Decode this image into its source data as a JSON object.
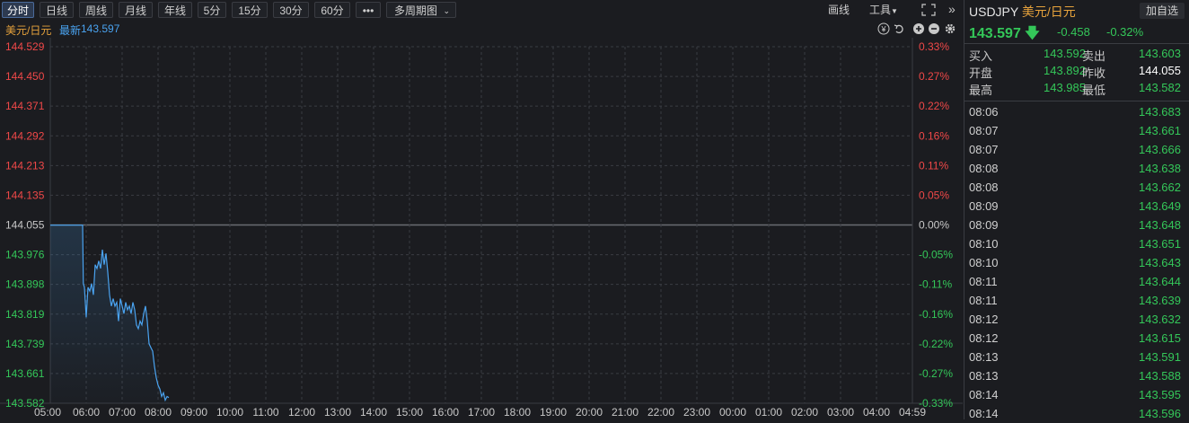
{
  "toolbar": {
    "periods": [
      "分时",
      "日线",
      "周线",
      "月线",
      "年线",
      "5分",
      "15分",
      "30分",
      "60分"
    ],
    "more_label": "•••",
    "multi_label": "多周期图",
    "draw_label": "画线",
    "tools_label": "工具"
  },
  "subheader": {
    "name": "美元/日元",
    "latest_label": "最新",
    "latest_value": "143.597"
  },
  "colors": {
    "up": "#f04848",
    "down": "#34c759",
    "line": "#4aa3f0",
    "neutral": "#c8c8c8"
  },
  "chart_data": {
    "type": "line",
    "y_ticks": [
      "144.529",
      "144.450",
      "144.371",
      "144.292",
      "144.213",
      "144.135",
      "144.055",
      "143.976",
      "143.898",
      "143.819",
      "143.739",
      "143.661",
      "143.582"
    ],
    "pct_ticks": [
      "0.33%",
      "0.27%",
      "0.22%",
      "0.16%",
      "0.11%",
      "0.05%",
      "0.00%",
      "-0.05%",
      "-0.11%",
      "-0.16%",
      "-0.22%",
      "-0.27%",
      "-0.33%"
    ],
    "x_ticks": [
      "05:00",
      "06:00",
      "07:00",
      "08:00",
      "09:00",
      "10:00",
      "11:00",
      "12:00",
      "13:00",
      "14:00",
      "15:00",
      "16:00",
      "17:00",
      "18:00",
      "19:00",
      "20:00",
      "21:00",
      "22:00",
      "23:00",
      "00:00",
      "01:00",
      "02:00",
      "03:00",
      "04:00",
      "04:59"
    ],
    "ylim": [
      143.582,
      144.529
    ],
    "prev_close": 144.055,
    "series": [
      {
        "x": [
          0.0,
          0.9,
          0.92,
          0.95,
          1.0,
          1.05,
          1.1,
          1.15,
          1.2,
          1.25,
          1.3,
          1.35,
          1.4,
          1.45,
          1.5,
          1.55,
          1.6,
          1.65,
          1.7,
          1.75,
          1.8,
          1.85,
          1.9,
          1.95,
          2.0,
          2.05,
          2.1,
          2.15,
          2.2,
          2.25,
          2.3,
          2.35,
          2.4,
          2.45,
          2.5,
          2.55,
          2.6,
          2.65,
          2.7,
          2.75,
          2.8,
          2.85,
          2.9,
          2.95,
          3.0,
          3.05,
          3.1,
          3.15,
          3.2,
          3.25,
          3.3
        ],
        "values": [
          144.055,
          144.055,
          143.9,
          143.89,
          143.81,
          143.89,
          143.88,
          143.9,
          143.87,
          143.95,
          143.94,
          143.96,
          143.94,
          143.99,
          143.95,
          143.98,
          143.93,
          143.87,
          143.84,
          143.86,
          143.84,
          143.85,
          143.8,
          143.86,
          143.84,
          143.82,
          143.85,
          143.83,
          143.84,
          143.82,
          143.85,
          143.83,
          143.79,
          143.78,
          143.8,
          143.79,
          143.82,
          143.84,
          143.8,
          143.74,
          143.73,
          143.72,
          143.68,
          143.65,
          143.63,
          143.62,
          143.6,
          143.61,
          143.59,
          143.6,
          143.597
        ]
      }
    ]
  },
  "panel": {
    "symbol": "USDJPY",
    "symbol_cn": "美元/日元",
    "add_label": "加自选",
    "price": "143.597",
    "change": "-0.458",
    "change_pct": "-0.32%",
    "quotes": [
      {
        "l1": "买入",
        "v1": "143.592",
        "c1": "down",
        "l2": "卖出",
        "v2": "143.603",
        "c2": "down"
      },
      {
        "l1": "开盘",
        "v1": "143.892",
        "c1": "down",
        "l2": "昨收",
        "v2": "144.055",
        "c2": "neutral"
      },
      {
        "l1": "最高",
        "v1": "143.985",
        "c1": "down",
        "l2": "最低",
        "v2": "143.582",
        "c2": "down"
      }
    ],
    "ticks": [
      {
        "time": "08:06",
        "price": "143.683"
      },
      {
        "time": "08:07",
        "price": "143.661"
      },
      {
        "time": "08:07",
        "price": "143.666"
      },
      {
        "time": "08:08",
        "price": "143.638"
      },
      {
        "time": "08:08",
        "price": "143.662"
      },
      {
        "time": "08:09",
        "price": "143.649"
      },
      {
        "time": "08:09",
        "price": "143.648"
      },
      {
        "time": "08:10",
        "price": "143.651"
      },
      {
        "time": "08:10",
        "price": "143.643"
      },
      {
        "time": "08:11",
        "price": "143.644"
      },
      {
        "time": "08:11",
        "price": "143.639"
      },
      {
        "time": "08:12",
        "price": "143.632"
      },
      {
        "time": "08:12",
        "price": "143.615"
      },
      {
        "time": "08:13",
        "price": "143.591"
      },
      {
        "time": "08:13",
        "price": "143.588"
      },
      {
        "time": "08:14",
        "price": "143.595"
      },
      {
        "time": "08:14",
        "price": "143.596"
      }
    ]
  }
}
